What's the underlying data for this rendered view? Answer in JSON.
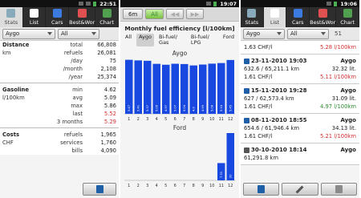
{
  "colors": {
    "bar": "#1848e0",
    "accent_green": "#7ac142",
    "red": "#d32f2f"
  },
  "tabs": [
    {
      "label": "Stats",
      "icon": "stats-icon"
    },
    {
      "label": "List",
      "icon": "list-icon"
    },
    {
      "label": "Cars",
      "icon": "car-icon"
    },
    {
      "label": "Best&Wor",
      "icon": "trophy-icon"
    },
    {
      "label": "Chart",
      "icon": "chart-icon"
    }
  ],
  "screen1": {
    "time": "22:51",
    "car": "Aygo",
    "fuel": "All",
    "distance": {
      "title": "Distance",
      "unit": "km",
      "rows": [
        {
          "label": "total",
          "value": "66,808"
        },
        {
          "label": "refuels",
          "value": "26,081"
        },
        {
          "label": "/day",
          "value": "75"
        },
        {
          "label": "/month",
          "value": "2,108"
        },
        {
          "label": "/year",
          "value": "25,374"
        }
      ]
    },
    "gasoline": {
      "title": "Gasoline",
      "unit": "l/100km",
      "rows": [
        {
          "label": "min",
          "value": "4.62"
        },
        {
          "label": "avg",
          "value": "5.09"
        },
        {
          "label": "max",
          "value": "5.86"
        },
        {
          "label": "last",
          "value": "5.52"
        },
        {
          "label": "3 months",
          "value": "5.29"
        }
      ]
    },
    "costs": {
      "title": "Costs",
      "unit": "CHF",
      "rows": [
        {
          "label": "refuels",
          "value": "1,965"
        },
        {
          "label": "services",
          "value": "1,760"
        },
        {
          "label": "bills",
          "value": "4,090"
        }
      ]
    }
  },
  "screen2": {
    "time": "19:07",
    "btn_6m": "6m",
    "btn_all": "All",
    "title": "Monthly fuel efficiency [l/100km]",
    "chips": [
      "All",
      "Aygo",
      "Bi-fuel/ Gas",
      "Bi-fuel/ LPG",
      "Ford"
    ],
    "chart_data": [
      {
        "type": "bar",
        "title": "Aygo",
        "categories": [
          "1",
          "2",
          "3",
          "4",
          "5",
          "6",
          "7",
          "8",
          "9",
          "10",
          "11",
          "12"
        ],
        "values": [
          5.47,
          5.41,
          5.37,
          5.06,
          4.97,
          5.07,
          5.04,
          4.9,
          4.99,
          5.08,
          5.14,
          5.45
        ],
        "ylim": [
          0,
          5.6
        ]
      },
      {
        "type": "bar",
        "title": "Ford",
        "categories": [
          "1",
          "2",
          "3",
          "4",
          "5",
          "6",
          "7",
          "8",
          "9",
          "10",
          "11",
          "12"
        ],
        "values": [
          0,
          0,
          0,
          0,
          0,
          0,
          0,
          0,
          0,
          0,
          7.31,
          20.0
        ],
        "ylim": [
          0,
          20
        ]
      }
    ]
  },
  "screen3": {
    "time": "19:06",
    "car": "Aygo",
    "fuel": "All",
    "odo": "51",
    "entries": [
      {
        "rows": [
          [
            {
              "t": "1.63 CHF/l"
            },
            {
              "t": "5.28 l/100km",
              "c": "red"
            }
          ]
        ]
      },
      {
        "icon": "pump-icon",
        "rows": [
          [
            {
              "t": "23-11-2010 19:03",
              "b": 1
            },
            {
              "t": "Aygo"
            }
          ],
          [
            {
              "t": "632.6 / 65,211.1 km"
            },
            {
              "t": "32.32 lit."
            }
          ],
          [
            {
              "t": "1.61 CHF/l"
            },
            {
              "t": "5.11 l/100km",
              "c": "red"
            }
          ]
        ]
      },
      {
        "icon": "pump-icon",
        "rows": [
          [
            {
              "t": "15-11-2010 19:28",
              "b": 1
            },
            {
              "t": "Aygo"
            }
          ],
          [
            {
              "t": "627 / 62,573.4 km"
            },
            {
              "t": "31.09 lit."
            }
          ],
          [
            {
              "t": "1.61 CHF/l"
            },
            {
              "t": "4.97 l/100km",
              "c": "green"
            }
          ]
        ]
      },
      {
        "icon": "pump-icon",
        "rows": [
          [
            {
              "t": "08-11-2010 18:55",
              "b": 1
            },
            {
              "t": "Aygo"
            }
          ],
          [
            {
              "t": "654.6 / 61,946.4 km"
            },
            {
              "t": "34.13 lit."
            }
          ],
          [
            {
              "t": "1.61 CHF/l"
            },
            {
              "t": "5.21 l/100km",
              "c": "red"
            }
          ]
        ]
      },
      {
        "icon": "wrench-icon",
        "rows": [
          [
            {
              "t": "30-10-2010 18:14",
              "b": 1
            },
            {
              "t": "Aygo"
            }
          ],
          [
            {
              "t": "61,291.8 km"
            },
            {
              "t": ""
            }
          ]
        ]
      }
    ]
  }
}
